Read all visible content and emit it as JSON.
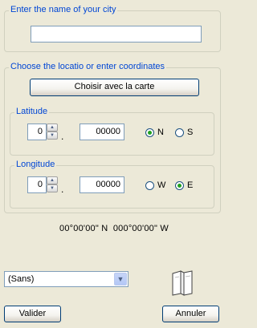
{
  "city": {
    "legend": "Enter the name of your city",
    "input_value": ""
  },
  "locate": {
    "legend": "Choose the locatio or enter coordinates",
    "map_button": "Choisir avec la carte"
  },
  "latitude": {
    "legend": "Latitude",
    "degrees": "0",
    "separator": ".",
    "minutes": "00000",
    "options": [
      "N",
      "S"
    ],
    "selected": "N"
  },
  "longitude": {
    "legend": "Longitude",
    "degrees": "0",
    "separator": ".",
    "minutes": "00000",
    "options": [
      "W",
      "E"
    ],
    "selected": "E"
  },
  "coordinates_text": "00°00'00\" N  000°00'00\" W",
  "preset": {
    "selected": "(Sans)"
  },
  "buttons": {
    "ok": "Valider",
    "cancel": "Annuler"
  },
  "icons": {
    "map": "map-book-icon",
    "spin": "spin-arrows-icon",
    "dropdown": "chevron-down-icon"
  }
}
